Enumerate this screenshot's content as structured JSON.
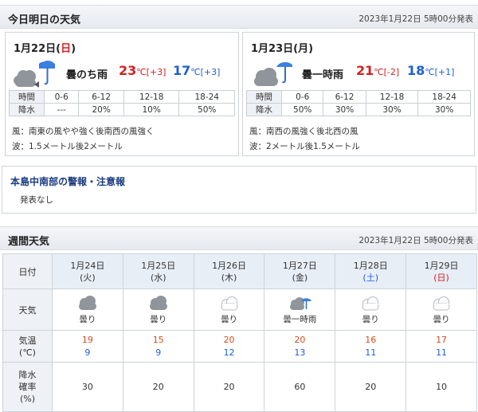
{
  "today_section": {
    "title": "今日明日の天気",
    "issued": "2023年1月22日 5時00分発表"
  },
  "days": [
    {
      "date_main": "1月22日(",
      "date_dow": "日",
      "date_close": ")",
      "dow_color": "#d71e1e",
      "icon": "cloud-then-rain-icon",
      "weather": "曇のち雨",
      "high": "23",
      "high_unit": "℃",
      "high_diff": "[+3]",
      "low": "17",
      "low_unit": "℃",
      "low_diff": "[+3]",
      "time_header": "時間",
      "periods": [
        "0-6",
        "6-12",
        "12-18",
        "18-24"
      ],
      "precip_header": "降水",
      "precip": [
        "---",
        "20%",
        "10%",
        "50%"
      ],
      "wind": "風：南東の風やや強く後南西の風強く",
      "wave": "波：1.5メートル後2メートル"
    },
    {
      "date_main": "1月23日(",
      "date_dow": "月",
      "date_close": ")",
      "dow_color": "#222222",
      "icon": "cloud-occasional-rain-icon",
      "weather": "曇一時雨",
      "high": "21",
      "high_unit": "℃",
      "high_diff": "[-2]",
      "low": "18",
      "low_unit": "℃",
      "low_diff": "[+1]",
      "time_header": "時間",
      "periods": [
        "0-6",
        "6-12",
        "12-18",
        "18-24"
      ],
      "precip_header": "降水",
      "precip": [
        "50%",
        "30%",
        "30%",
        "30%"
      ],
      "wind": "風：南西の風強く後北西の風",
      "wave": "波：2メートル後1.5メートル"
    }
  ],
  "warnings": {
    "title": "本島中南部の警報・注意報",
    "body": "発表なし"
  },
  "weekly_section": {
    "title": "週間天気",
    "issued": "2023年1月22日 5時00分発表"
  },
  "weekly": {
    "row_date": "日付",
    "row_weather": "天気",
    "row_temp_1": "気温",
    "row_temp_2": "(℃)",
    "row_pop_1": "降水",
    "row_pop_2": "確率",
    "row_pop_3": "(%)",
    "days": [
      {
        "date": "1月24日",
        "dow": "(火)",
        "dow_color": "#333333",
        "icon": "cloud-icon",
        "weather": "曇り",
        "high": "19",
        "low": "9",
        "pop": "30"
      },
      {
        "date": "1月25日",
        "dow": "(水)",
        "dow_color": "#333333",
        "icon": "cloud-icon",
        "weather": "曇り",
        "high": "15",
        "low": "9",
        "pop": "20"
      },
      {
        "date": "1月26日",
        "dow": "(木)",
        "dow_color": "#333333",
        "icon": "cloud-light-icon",
        "weather": "曇り",
        "high": "20",
        "low": "12",
        "pop": "20"
      },
      {
        "date": "1月27日",
        "dow": "(金)",
        "dow_color": "#333333",
        "icon": "cloud-occasional-rain-icon",
        "weather": "曇一時雨",
        "high": "20",
        "low": "13",
        "pop": "60"
      },
      {
        "date": "1月28日",
        "dow": "(土)",
        "dow_color": "#1e5fd2",
        "icon": "cloud-light-icon",
        "weather": "曇り",
        "high": "16",
        "low": "11",
        "pop": "20"
      },
      {
        "date": "1月29日",
        "dow": "(日)",
        "dow_color": "#d71e1e",
        "icon": "cloud-light-icon",
        "weather": "曇り",
        "high": "17",
        "low": "11",
        "pop": "10"
      }
    ]
  }
}
